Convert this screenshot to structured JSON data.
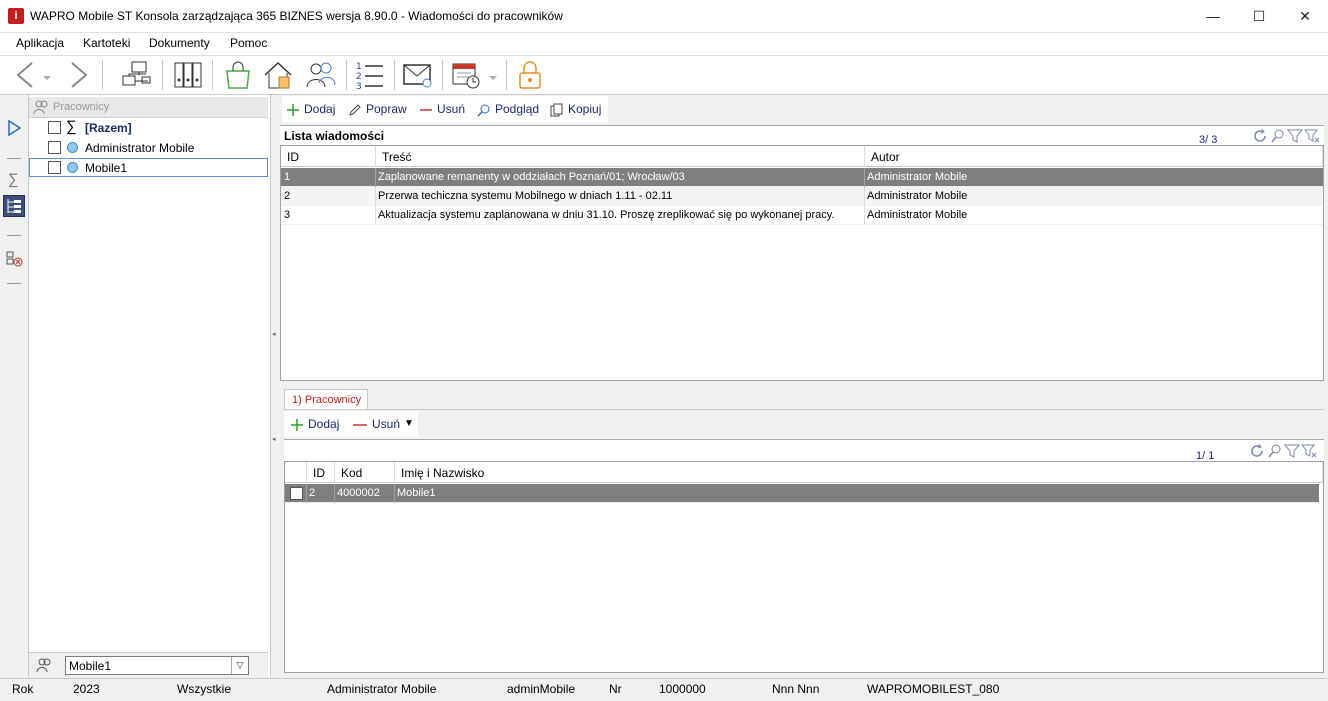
{
  "window": {
    "title": "WAPRO Mobile ST Konsola zarządzająca 365 BIZNES wersja 8.90.0 - Wiadomości do pracowników",
    "app_icon_letter": "i",
    "min": "—",
    "max": "☐",
    "close": "✕"
  },
  "menu": [
    "Aplikacja",
    "Kartoteki",
    "Dokumenty",
    "Pomoc"
  ],
  "tree": {
    "header": "Pracownicy",
    "items": [
      {
        "label": "[Razem]",
        "type": "sum"
      },
      {
        "label": "Administrator Mobile",
        "type": "user"
      },
      {
        "label": "Mobile1",
        "type": "user",
        "selected": true
      }
    ],
    "sum_symbol": "∑",
    "footer_value": "Mobile1",
    "combo_arrow": "▽"
  },
  "left_strip": {
    "sum_symbol": "∑"
  },
  "actions_top": [
    "Dodaj",
    "Popraw",
    "Usuń",
    "Podgląd",
    "Kopiuj"
  ],
  "messages": {
    "title": "Lista wiadomości",
    "counter": "3/ 3",
    "columns": [
      "ID",
      "Treść",
      "Autor"
    ],
    "rows": [
      {
        "id": "1",
        "text": "Zaplanowane remanenty w oddziałach Poznań/01; Wrocław/03",
        "author": "Administrator Mobile",
        "selected": true
      },
      {
        "id": "2",
        "text": "Przerwa techiczna systemu Mobilnego w dniach 1.11 - 02.11",
        "author": "Administrator Mobile"
      },
      {
        "id": "3",
        "text": "Aktualizacja systemu zaplanowana w dniu 31.10. Proszę zreplikować się po wykonanej pracy.",
        "author": "Administrator Mobile"
      }
    ]
  },
  "tab": {
    "label": "1) Pracownicy"
  },
  "actions_bottom": [
    "Dodaj",
    "Usuń"
  ],
  "dropdown_arrow": "▼",
  "workers": {
    "counter": "1/ 1",
    "columns": [
      "ID",
      "Kod",
      "Imię i Nazwisko"
    ],
    "rows": [
      {
        "id": "2",
        "code": "4000002",
        "name": "Mobile1",
        "selected": true
      }
    ]
  },
  "status": {
    "rok_label": "Rok",
    "rok": "2023",
    "scope": "Wszystkie",
    "user": "Administrator Mobile",
    "login": "adminMobile",
    "nr_label": "Nr",
    "nr": "1000000",
    "nnn": "Nnn Nnn",
    "db": "WAPROMOBILEST_080"
  },
  "colors": {
    "accent": "#1a2a6e",
    "selection": "#7f7f7f",
    "tab_text": "#c41e1e"
  }
}
